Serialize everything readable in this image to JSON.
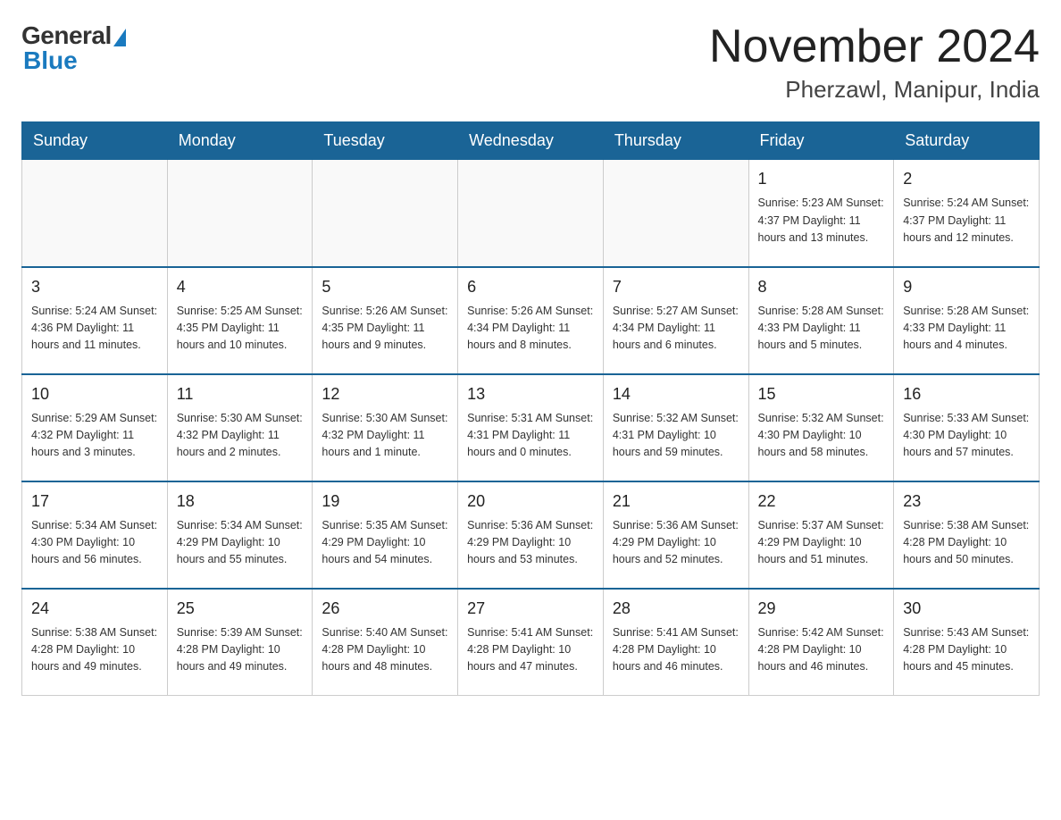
{
  "header": {
    "logo": {
      "text_general": "General",
      "text_blue": "Blue"
    },
    "title": "November 2024",
    "location": "Pherzawl, Manipur, India"
  },
  "days_of_week": [
    "Sunday",
    "Monday",
    "Tuesday",
    "Wednesday",
    "Thursday",
    "Friday",
    "Saturday"
  ],
  "weeks": [
    [
      {
        "day": "",
        "info": ""
      },
      {
        "day": "",
        "info": ""
      },
      {
        "day": "",
        "info": ""
      },
      {
        "day": "",
        "info": ""
      },
      {
        "day": "",
        "info": ""
      },
      {
        "day": "1",
        "info": "Sunrise: 5:23 AM\nSunset: 4:37 PM\nDaylight: 11 hours and 13 minutes."
      },
      {
        "day": "2",
        "info": "Sunrise: 5:24 AM\nSunset: 4:37 PM\nDaylight: 11 hours and 12 minutes."
      }
    ],
    [
      {
        "day": "3",
        "info": "Sunrise: 5:24 AM\nSunset: 4:36 PM\nDaylight: 11 hours and 11 minutes."
      },
      {
        "day": "4",
        "info": "Sunrise: 5:25 AM\nSunset: 4:35 PM\nDaylight: 11 hours and 10 minutes."
      },
      {
        "day": "5",
        "info": "Sunrise: 5:26 AM\nSunset: 4:35 PM\nDaylight: 11 hours and 9 minutes."
      },
      {
        "day": "6",
        "info": "Sunrise: 5:26 AM\nSunset: 4:34 PM\nDaylight: 11 hours and 8 minutes."
      },
      {
        "day": "7",
        "info": "Sunrise: 5:27 AM\nSunset: 4:34 PM\nDaylight: 11 hours and 6 minutes."
      },
      {
        "day": "8",
        "info": "Sunrise: 5:28 AM\nSunset: 4:33 PM\nDaylight: 11 hours and 5 minutes."
      },
      {
        "day": "9",
        "info": "Sunrise: 5:28 AM\nSunset: 4:33 PM\nDaylight: 11 hours and 4 minutes."
      }
    ],
    [
      {
        "day": "10",
        "info": "Sunrise: 5:29 AM\nSunset: 4:32 PM\nDaylight: 11 hours and 3 minutes."
      },
      {
        "day": "11",
        "info": "Sunrise: 5:30 AM\nSunset: 4:32 PM\nDaylight: 11 hours and 2 minutes."
      },
      {
        "day": "12",
        "info": "Sunrise: 5:30 AM\nSunset: 4:32 PM\nDaylight: 11 hours and 1 minute."
      },
      {
        "day": "13",
        "info": "Sunrise: 5:31 AM\nSunset: 4:31 PM\nDaylight: 11 hours and 0 minutes."
      },
      {
        "day": "14",
        "info": "Sunrise: 5:32 AM\nSunset: 4:31 PM\nDaylight: 10 hours and 59 minutes."
      },
      {
        "day": "15",
        "info": "Sunrise: 5:32 AM\nSunset: 4:30 PM\nDaylight: 10 hours and 58 minutes."
      },
      {
        "day": "16",
        "info": "Sunrise: 5:33 AM\nSunset: 4:30 PM\nDaylight: 10 hours and 57 minutes."
      }
    ],
    [
      {
        "day": "17",
        "info": "Sunrise: 5:34 AM\nSunset: 4:30 PM\nDaylight: 10 hours and 56 minutes."
      },
      {
        "day": "18",
        "info": "Sunrise: 5:34 AM\nSunset: 4:29 PM\nDaylight: 10 hours and 55 minutes."
      },
      {
        "day": "19",
        "info": "Sunrise: 5:35 AM\nSunset: 4:29 PM\nDaylight: 10 hours and 54 minutes."
      },
      {
        "day": "20",
        "info": "Sunrise: 5:36 AM\nSunset: 4:29 PM\nDaylight: 10 hours and 53 minutes."
      },
      {
        "day": "21",
        "info": "Sunrise: 5:36 AM\nSunset: 4:29 PM\nDaylight: 10 hours and 52 minutes."
      },
      {
        "day": "22",
        "info": "Sunrise: 5:37 AM\nSunset: 4:29 PM\nDaylight: 10 hours and 51 minutes."
      },
      {
        "day": "23",
        "info": "Sunrise: 5:38 AM\nSunset: 4:28 PM\nDaylight: 10 hours and 50 minutes."
      }
    ],
    [
      {
        "day": "24",
        "info": "Sunrise: 5:38 AM\nSunset: 4:28 PM\nDaylight: 10 hours and 49 minutes."
      },
      {
        "day": "25",
        "info": "Sunrise: 5:39 AM\nSunset: 4:28 PM\nDaylight: 10 hours and 49 minutes."
      },
      {
        "day": "26",
        "info": "Sunrise: 5:40 AM\nSunset: 4:28 PM\nDaylight: 10 hours and 48 minutes."
      },
      {
        "day": "27",
        "info": "Sunrise: 5:41 AM\nSunset: 4:28 PM\nDaylight: 10 hours and 47 minutes."
      },
      {
        "day": "28",
        "info": "Sunrise: 5:41 AM\nSunset: 4:28 PM\nDaylight: 10 hours and 46 minutes."
      },
      {
        "day": "29",
        "info": "Sunrise: 5:42 AM\nSunset: 4:28 PM\nDaylight: 10 hours and 46 minutes."
      },
      {
        "day": "30",
        "info": "Sunrise: 5:43 AM\nSunset: 4:28 PM\nDaylight: 10 hours and 45 minutes."
      }
    ]
  ]
}
